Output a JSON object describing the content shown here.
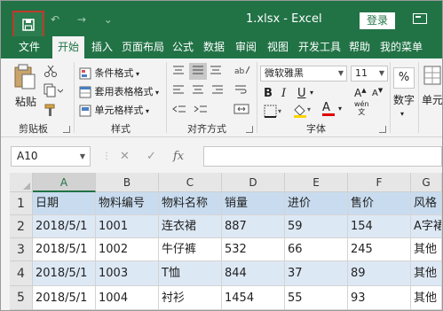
{
  "window": {
    "title": "1.xlsx  -  Excel",
    "login_label": "登录",
    "qat_arrows": "↶ → ⌄"
  },
  "tabs": [
    {
      "label": "文件",
      "active": false
    },
    {
      "label": "开始",
      "active": true
    },
    {
      "label": "插入",
      "active": false
    },
    {
      "label": "页面布局",
      "active": false
    },
    {
      "label": "公式",
      "active": false
    },
    {
      "label": "数据",
      "active": false
    },
    {
      "label": "审阅",
      "active": false
    },
    {
      "label": "视图",
      "active": false
    },
    {
      "label": "开发工具",
      "active": false
    },
    {
      "label": "帮助",
      "active": false
    },
    {
      "label": "我的菜单",
      "active": false
    }
  ],
  "ribbon": {
    "clipboard": {
      "paste_label": "粘贴",
      "group_label": "剪贴板"
    },
    "styles": {
      "conditional_format": "条件格式",
      "table_format": "套用表格格式",
      "cell_styles": "单元格样式",
      "group_label": "样式"
    },
    "alignment": {
      "group_label": "对齐方式"
    },
    "font": {
      "font_name": "微软雅黑",
      "font_size": "11",
      "group_label": "字体",
      "bold": "B",
      "italic": "I",
      "underline": "U",
      "font_color_letter": "A",
      "wen_label": "wén\n文"
    },
    "number": {
      "label": "数字",
      "percent": "%"
    },
    "cells": {
      "label": "单元"
    }
  },
  "formula_bar": {
    "name_box": "A10",
    "fx": "fx",
    "cancel": "✕",
    "enter": "✓",
    "formula": ""
  },
  "sheet": {
    "columns": [
      "A",
      "B",
      "C",
      "D",
      "E",
      "F",
      "G"
    ],
    "selected_column": "A",
    "rows": [
      {
        "num": "1",
        "cells": [
          "日期",
          "物料编号",
          "物料名称",
          "销量",
          "进价",
          "售价",
          "风格"
        ]
      },
      {
        "num": "2",
        "cells": [
          "2018/5/1",
          "1001",
          "连衣裙",
          "887",
          "59",
          "154",
          "A字裙"
        ]
      },
      {
        "num": "3",
        "cells": [
          "2018/5/1",
          "1002",
          "牛仔裤",
          "532",
          "66",
          "245",
          "其他"
        ]
      },
      {
        "num": "4",
        "cells": [
          "2018/5/1",
          "1003",
          "T恤",
          "844",
          "37",
          "89",
          "其他"
        ]
      },
      {
        "num": "5",
        "cells": [
          "2018/5/1",
          "1004",
          "衬衫",
          "1454",
          "55",
          "93",
          "其他"
        ]
      }
    ]
  },
  "colors": {
    "excel_green": "#217346",
    "header_fill": "#c9dcef",
    "band_fill": "#dde8f5"
  }
}
